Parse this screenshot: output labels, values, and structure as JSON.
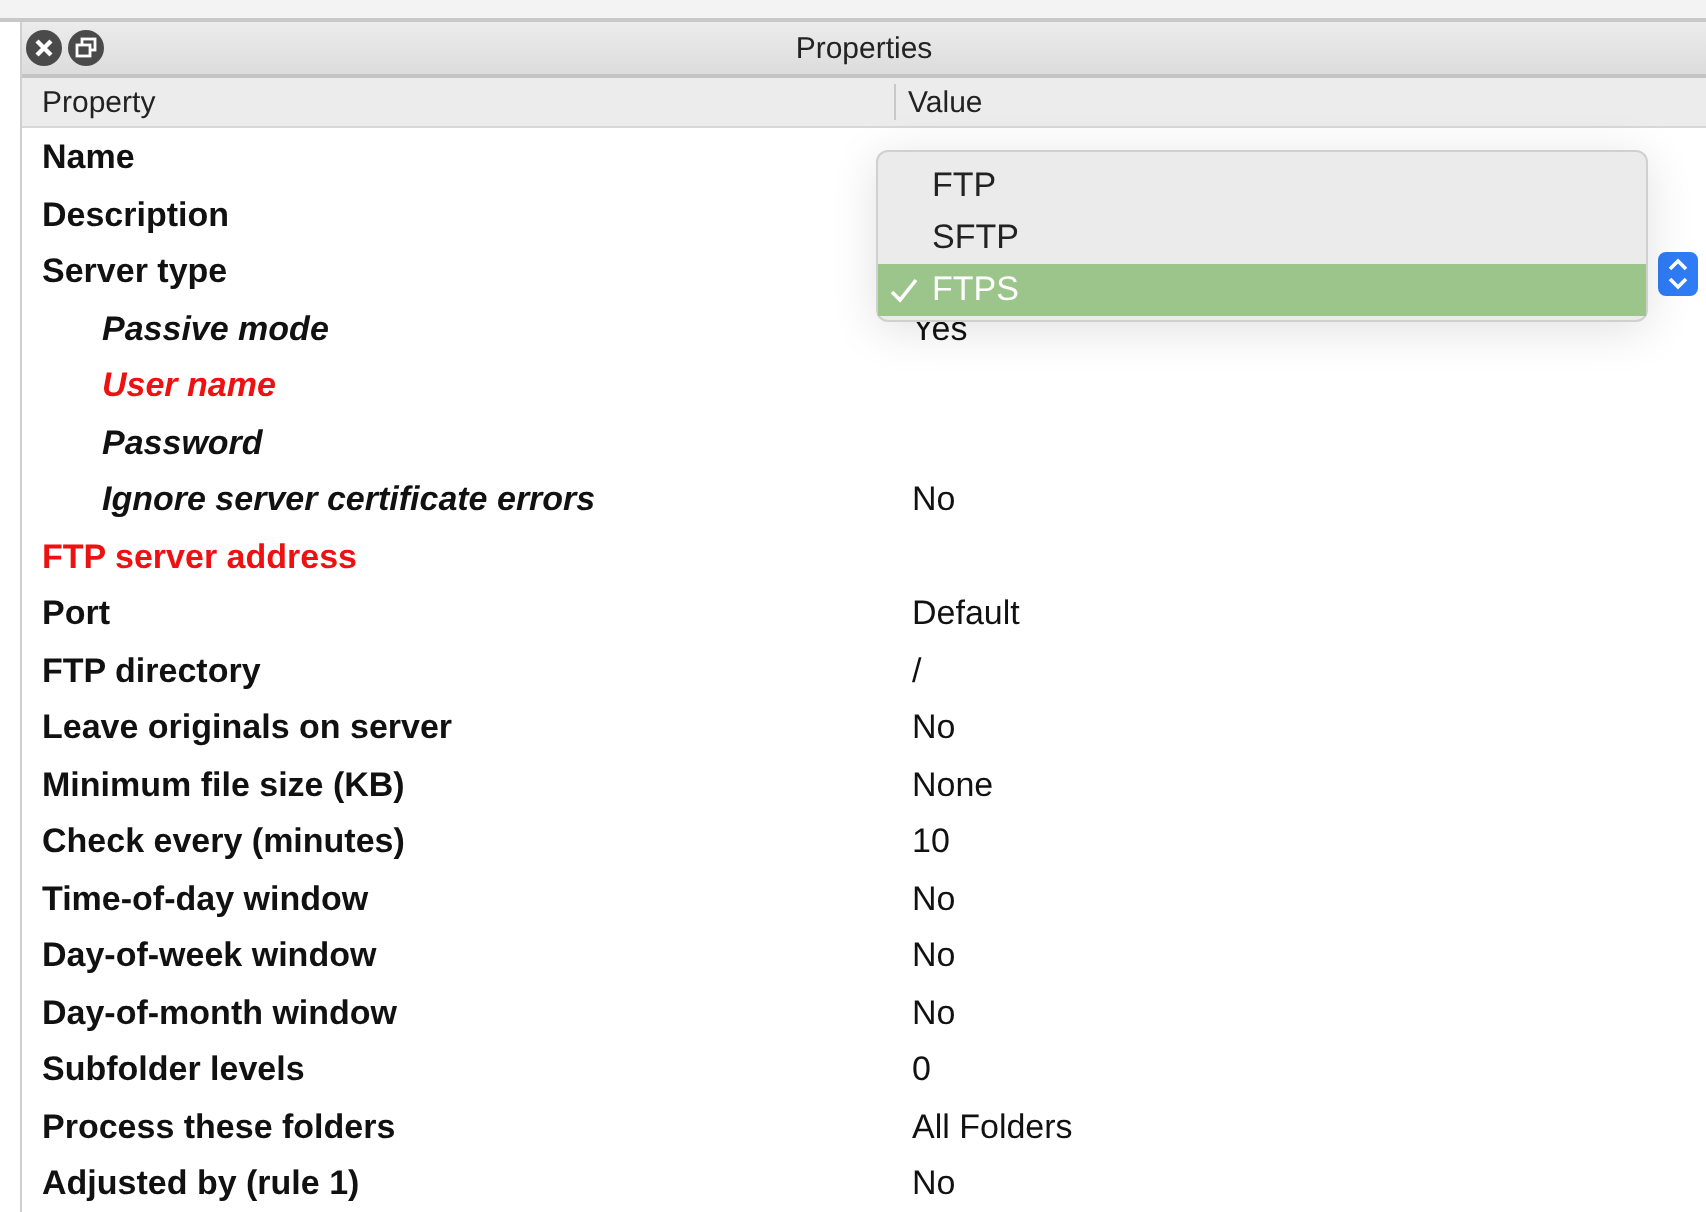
{
  "window": {
    "title": "Properties"
  },
  "columns": [
    "Property",
    "Value"
  ],
  "rows": [
    {
      "name": "Name",
      "required": false
    },
    {
      "name": "Description",
      "required": false
    },
    {
      "name": "Server type",
      "required": false,
      "dropdown": {
        "options": [
          {
            "label": "FTP",
            "selected": false
          },
          {
            "label": "SFTP",
            "selected": false
          },
          {
            "label": "FTPS",
            "selected": true
          }
        ]
      },
      "children": [
        {
          "name": "Passive mode",
          "required": false,
          "value": "Yes"
        },
        {
          "name": "User name",
          "required": true
        },
        {
          "name": "Password",
          "required": false
        },
        {
          "name": "Ignore server certificate errors",
          "required": false,
          "value": "No"
        }
      ]
    },
    {
      "name": "FTP server address",
      "required": true
    },
    {
      "name": "Port",
      "required": false,
      "value": "Default"
    },
    {
      "name": "FTP directory",
      "required": false,
      "value": "/"
    },
    {
      "name": "Leave originals on server",
      "required": false,
      "value": "No"
    },
    {
      "name": "Minimum file size (KB)",
      "required": false,
      "value": "None"
    },
    {
      "name": "Check every (minutes)",
      "required": false,
      "value": "10"
    },
    {
      "name": "Time-of-day window",
      "required": false,
      "value": "No"
    },
    {
      "name": "Day-of-week window",
      "required": false,
      "value": "No"
    },
    {
      "name": "Day-of-month window",
      "required": false,
      "value": "No"
    },
    {
      "name": "Subfolder levels",
      "required": false,
      "value": "0"
    },
    {
      "name": "Process these folders",
      "required": false,
      "value": "All Folders"
    },
    {
      "name": "Adjusted by (rule 1)",
      "required": false,
      "value": "No"
    }
  ]
}
